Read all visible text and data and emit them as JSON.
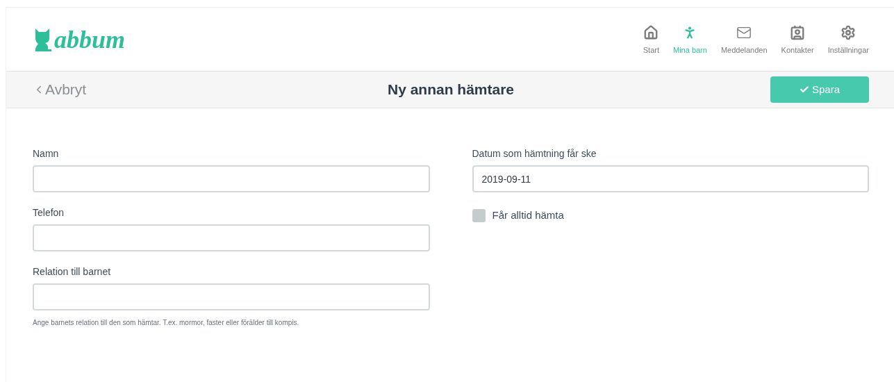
{
  "logo": {
    "text": "abbum"
  },
  "nav": [
    {
      "label": "Start",
      "kind": "home",
      "selected": false
    },
    {
      "label": "Mina barn",
      "kind": "child",
      "selected": true
    },
    {
      "label": "Meddelanden",
      "kind": "mail",
      "selected": false
    },
    {
      "label": "Kontakter",
      "kind": "contacts",
      "selected": false
    },
    {
      "label": "Inställningar",
      "kind": "settings",
      "selected": false
    }
  ],
  "toolbar": {
    "back": "Avbryt",
    "title": "Ny annan hämtare",
    "save": "Spara"
  },
  "left_fields": [
    {
      "label": "Namn"
    },
    {
      "label": "Telefon"
    },
    {
      "label": "Relation till barnet",
      "hint": "Ange barnets relation till den som hämtar. T.ex. mormor, faster eller förälder till kompis."
    }
  ],
  "right_fields": [
    {
      "label": "Datum som hämtning får ske",
      "value": "2019-09-11"
    }
  ],
  "checkbox": {
    "label": "Får alltid hämta",
    "checked": false
  }
}
